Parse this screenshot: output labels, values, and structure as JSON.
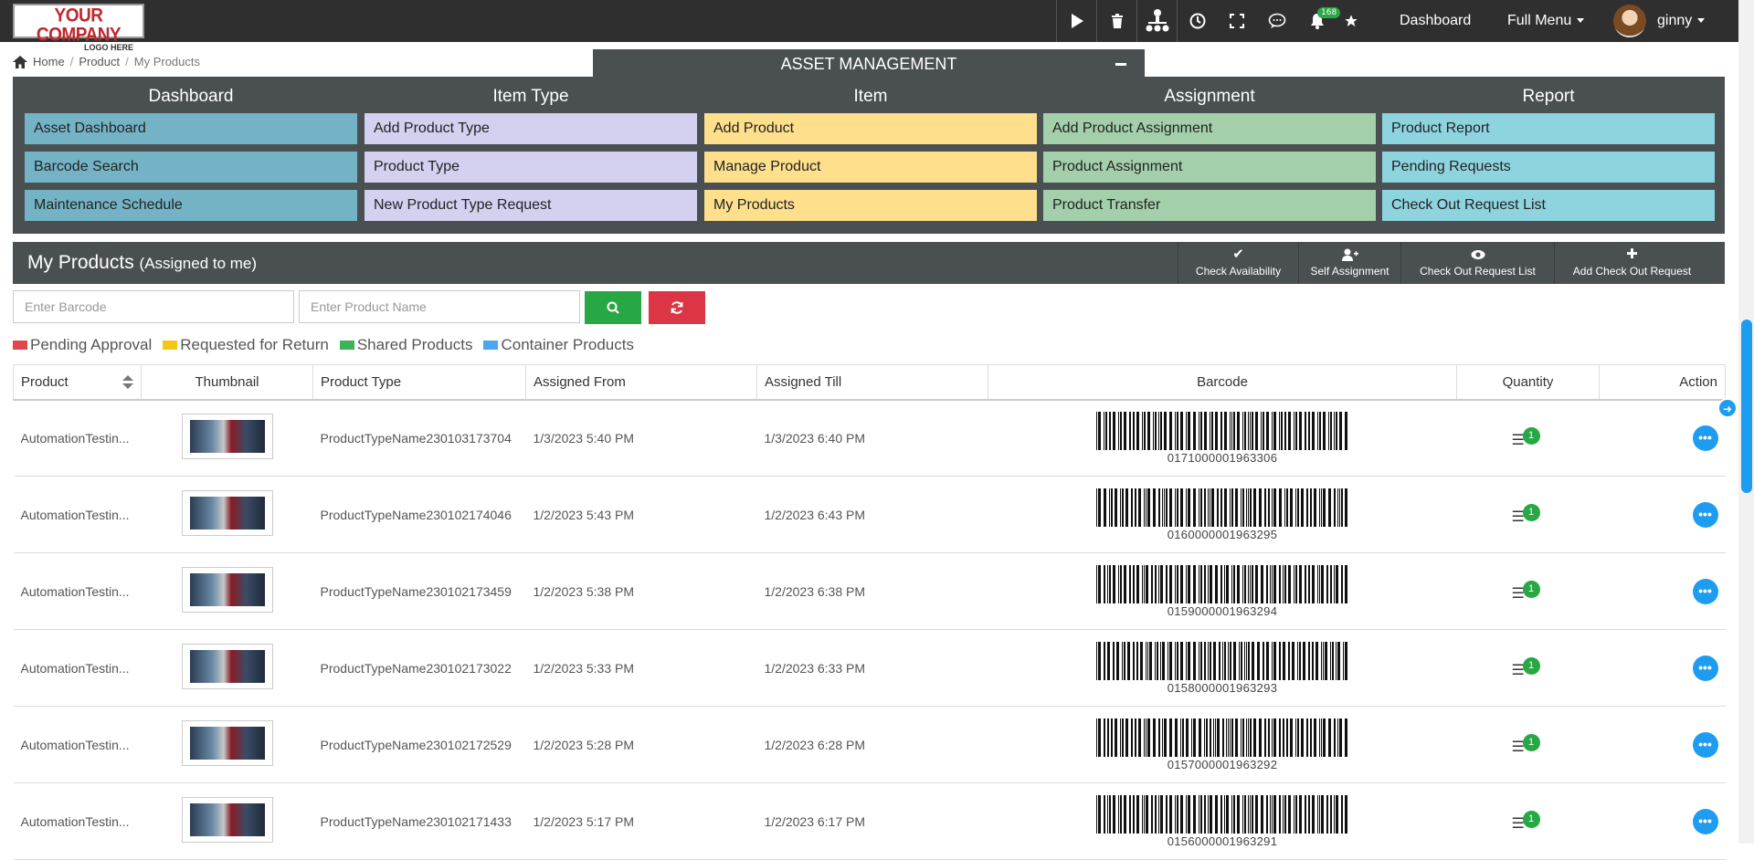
{
  "topbar": {
    "logo_line1": "YOUR COMPANY",
    "logo_line2": "LOGO HERE",
    "notification_count": "168",
    "dashboard_label": "Dashboard",
    "full_menu_label": "Full Menu",
    "user_name": "ginny",
    "icons": [
      "play-icon",
      "trash-icon",
      "network-icon",
      "clock-icon",
      "fullscreen-icon",
      "chat-icon",
      "bell-icon",
      "star-icon"
    ]
  },
  "breadcrumb": {
    "home": "Home",
    "product": "Product",
    "current": "My Products"
  },
  "asset_header": "ASSET MANAGEMENT",
  "menu": {
    "columns": [
      {
        "title": "Dashboard",
        "items": [
          "Asset Dashboard",
          "Barcode Search",
          "Maintenance Schedule"
        ]
      },
      {
        "title": "Item Type",
        "items": [
          "Add Product Type",
          "Product Type",
          "New Product Type Request"
        ]
      },
      {
        "title": "Item",
        "items": [
          "Add Product",
          "Manage Product",
          "My Products"
        ]
      },
      {
        "title": "Assignment",
        "items": [
          "Add Product Assignment",
          "Product Assignment",
          "Product Transfer"
        ]
      },
      {
        "title": "Report",
        "items": [
          "Product Report",
          "Pending Requests",
          "Check Out Request List"
        ]
      }
    ]
  },
  "page": {
    "title": "My Products",
    "subtitle": "(Assigned to me)",
    "buttons": [
      "Check Availability",
      "Self Assignment",
      "Check Out Request List",
      "Add Check Out Request"
    ]
  },
  "search": {
    "barcode_placeholder": "Enter Barcode",
    "product_placeholder": "Enter Product Name"
  },
  "legend": [
    {
      "label": "Pending Approval",
      "color": "#e0474c"
    },
    {
      "label": "Requested for Return",
      "color": "#f5c518"
    },
    {
      "label": "Shared Products",
      "color": "#3cb35a"
    },
    {
      "label": "Container Products",
      "color": "#4aa8f0"
    }
  ],
  "table": {
    "columns": [
      "Product",
      "Thumbnail",
      "Product Type",
      "Assigned From",
      "Assigned Till",
      "Barcode",
      "Quantity",
      "Action"
    ],
    "rows": [
      {
        "product": "AutomationTestin...",
        "type": "ProductTypeName230103173704",
        "from": "1/3/2023 5:40 PM",
        "till": "1/3/2023 6:40 PM",
        "barcode": "0171000001963306",
        "qty": "1"
      },
      {
        "product": "AutomationTestin...",
        "type": "ProductTypeName230102174046",
        "from": "1/2/2023 5:43 PM",
        "till": "1/2/2023 6:43 PM",
        "barcode": "0160000001963295",
        "qty": "1"
      },
      {
        "product": "AutomationTestin...",
        "type": "ProductTypeName230102173459",
        "from": "1/2/2023 5:38 PM",
        "till": "1/2/2023 6:38 PM",
        "barcode": "0159000001963294",
        "qty": "1"
      },
      {
        "product": "AutomationTestin...",
        "type": "ProductTypeName230102173022",
        "from": "1/2/2023 5:33 PM",
        "till": "1/2/2023 6:33 PM",
        "barcode": "0158000001963293",
        "qty": "1"
      },
      {
        "product": "AutomationTestin...",
        "type": "ProductTypeName230102172529",
        "from": "1/2/2023 5:28 PM",
        "till": "1/2/2023 6:28 PM",
        "barcode": "0157000001963292",
        "qty": "1"
      },
      {
        "product": "AutomationTestin...",
        "type": "ProductTypeName230102171433",
        "from": "1/2/2023 5:17 PM",
        "till": "1/2/2023 6:17 PM",
        "barcode": "0156000001963291",
        "qty": "1"
      }
    ]
  }
}
